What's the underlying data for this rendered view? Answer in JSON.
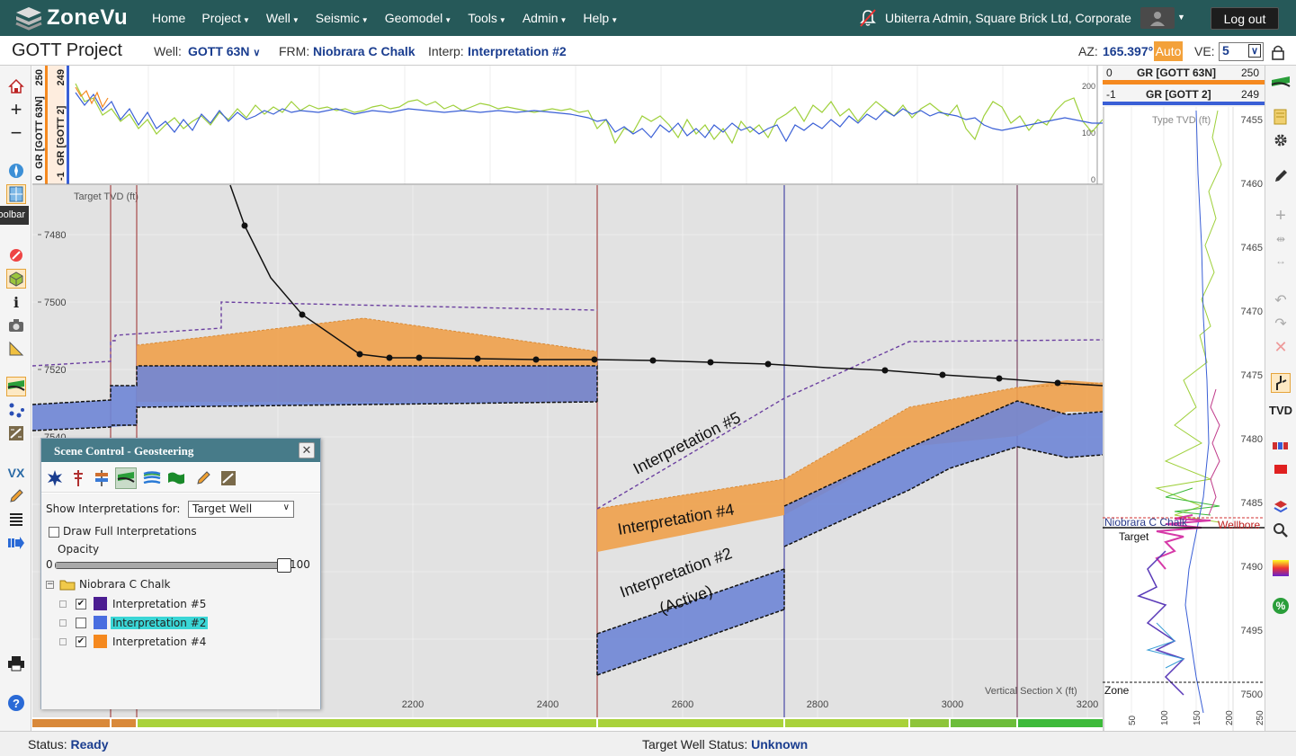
{
  "app": {
    "name": "ZoneVu"
  },
  "nav": {
    "items": [
      "Home",
      "Project",
      "Well",
      "Seismic",
      "Geomodel",
      "Tools",
      "Admin",
      "Help"
    ]
  },
  "user": {
    "label": "Ubiterra Admin, Square Brick Ltd, Corporate",
    "logout": "Log out"
  },
  "project": {
    "title": "GOTT Project"
  },
  "selectors": {
    "well_label": "Well:",
    "well_value": "GOTT 63N",
    "frm_label": "FRM:",
    "frm_value": "Niobrara C Chalk",
    "interp_label": "Interp:",
    "interp_value": "Interpretation #2",
    "az_label": "AZ:",
    "az_value": "165.397°",
    "auto": "Auto",
    "ve_label": "VE:",
    "ve_value": "5"
  },
  "tooltip": {
    "text": "Toolbar"
  },
  "log_panel": {
    "track1": {
      "name": "GR [GOTT 63N]",
      "min": "0",
      "max": "250"
    },
    "track2": {
      "name": "GR [GOTT 2]",
      "min": "-1",
      "max": "249"
    },
    "scale": [
      "200",
      "100",
      "0"
    ]
  },
  "section": {
    "y_label": "Target TVD (ft)",
    "x_label": "Vertical Section X (ft)",
    "y_ticks": [
      "7480",
      "7500",
      "7520",
      "7540"
    ],
    "x_ticks": [
      "2200",
      "2400",
      "2600",
      "2800",
      "3000",
      "3200"
    ],
    "labels": {
      "interp5": "Interpretation #5",
      "interp4": "Interpretation #4",
      "interp2_line1": "Interpretation #2",
      "interp2_line2": "(Active)"
    }
  },
  "type_well": {
    "header1": {
      "min": "0",
      "name": "GR [GOTT 63N]",
      "max": "250"
    },
    "header2": {
      "min": "-1",
      "name": "GR [GOTT 2]",
      "max": "249"
    },
    "y_label": "Type TVD (ft)",
    "y_ticks": [
      "7455",
      "7460",
      "7465",
      "7470",
      "7475",
      "7480",
      "7485",
      "7490",
      "7495",
      "7500"
    ],
    "x_ticks": [
      "50",
      "100",
      "150",
      "200",
      "250"
    ],
    "markers": {
      "formation": "Niobrara C Chalk",
      "wellbore": "Wellbore",
      "target": "Target",
      "zone": "Zone"
    }
  },
  "scene_control": {
    "title": "Scene Control - Geosteering",
    "show_label": "Show Interpretations for:",
    "show_value": "Target Well",
    "draw_full": "Draw Full Interpretations",
    "opacity_label": "Opacity",
    "opacity_min": "0",
    "opacity_max": "100",
    "opacity_value": 1.0,
    "folder": "Niobrara C Chalk",
    "items": [
      {
        "label": "Interpretation #5",
        "color": "#4b1d91",
        "checked": true,
        "active": false
      },
      {
        "label": "Interpretation #2",
        "color": "#4a6ee0",
        "checked": false,
        "active": true
      },
      {
        "label": "Interpretation #4",
        "color": "#f5891f",
        "checked": true,
        "active": false
      }
    ]
  },
  "colors": {
    "topnav": "#265959",
    "accent": "#1a3d8f",
    "interp4": "#f0a14b",
    "interp2": "#6f86d6",
    "interp5": "#6b3fa0"
  },
  "status": {
    "label": "Status:",
    "value": "Ready",
    "target_label": "Target Well Status:",
    "target_value": "Unknown"
  }
}
